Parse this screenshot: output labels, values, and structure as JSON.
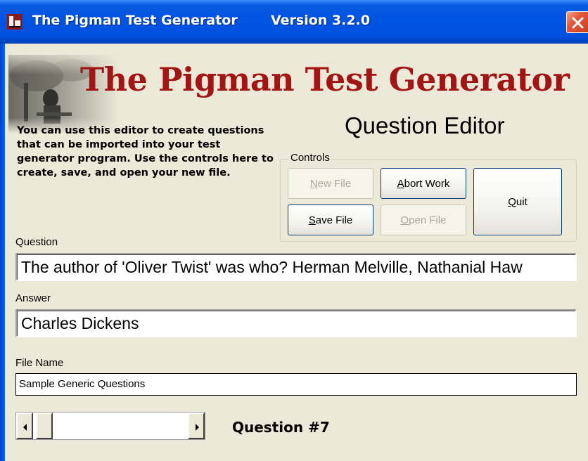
{
  "window": {
    "title": "The Pigman Test Generator",
    "version": "Version 3.2.0",
    "accent_color": "#0054e3",
    "close_color": "#e2573a"
  },
  "banner": {
    "title": "The Pigman Test Generator",
    "subtitle": "Question Editor",
    "title_color": "#a31515"
  },
  "intro": {
    "text": "You can use this editor to create questions that can be imported into your test generator program.  Use the controls here to create, save, and open your new file."
  },
  "controls": {
    "legend": "Controls",
    "new_file": {
      "label": "New File",
      "mnemonic": "N",
      "rest": "ew File",
      "enabled": false
    },
    "abort_work": {
      "label": "Abort Work",
      "mnemonic": "A",
      "rest": "bort Work",
      "enabled": true
    },
    "save_file": {
      "label": "Save File",
      "mnemonic": "S",
      "rest": "ave File",
      "enabled": true
    },
    "open_file": {
      "label": "Open File",
      "mnemonic": "O",
      "rest": "pen File",
      "enabled": false
    },
    "quit": {
      "label": "Quit",
      "mnemonic": "Q",
      "rest": "uit",
      "enabled": true
    }
  },
  "form": {
    "question_label": "Question",
    "question_value": "The author of 'Oliver Twist' was who? Herman Melville, Nathanial Haw",
    "answer_label": "Answer",
    "answer_value": "Charles Dickens",
    "filename_label": "File Name",
    "filename_value": "Sample Generic Questions"
  },
  "navigator": {
    "question_number_text": "Question #7"
  },
  "icons": {
    "app": "pigman-app-icon",
    "close": "close-icon",
    "scroll_left": "arrow-left-icon",
    "scroll_right": "arrow-right-icon"
  }
}
